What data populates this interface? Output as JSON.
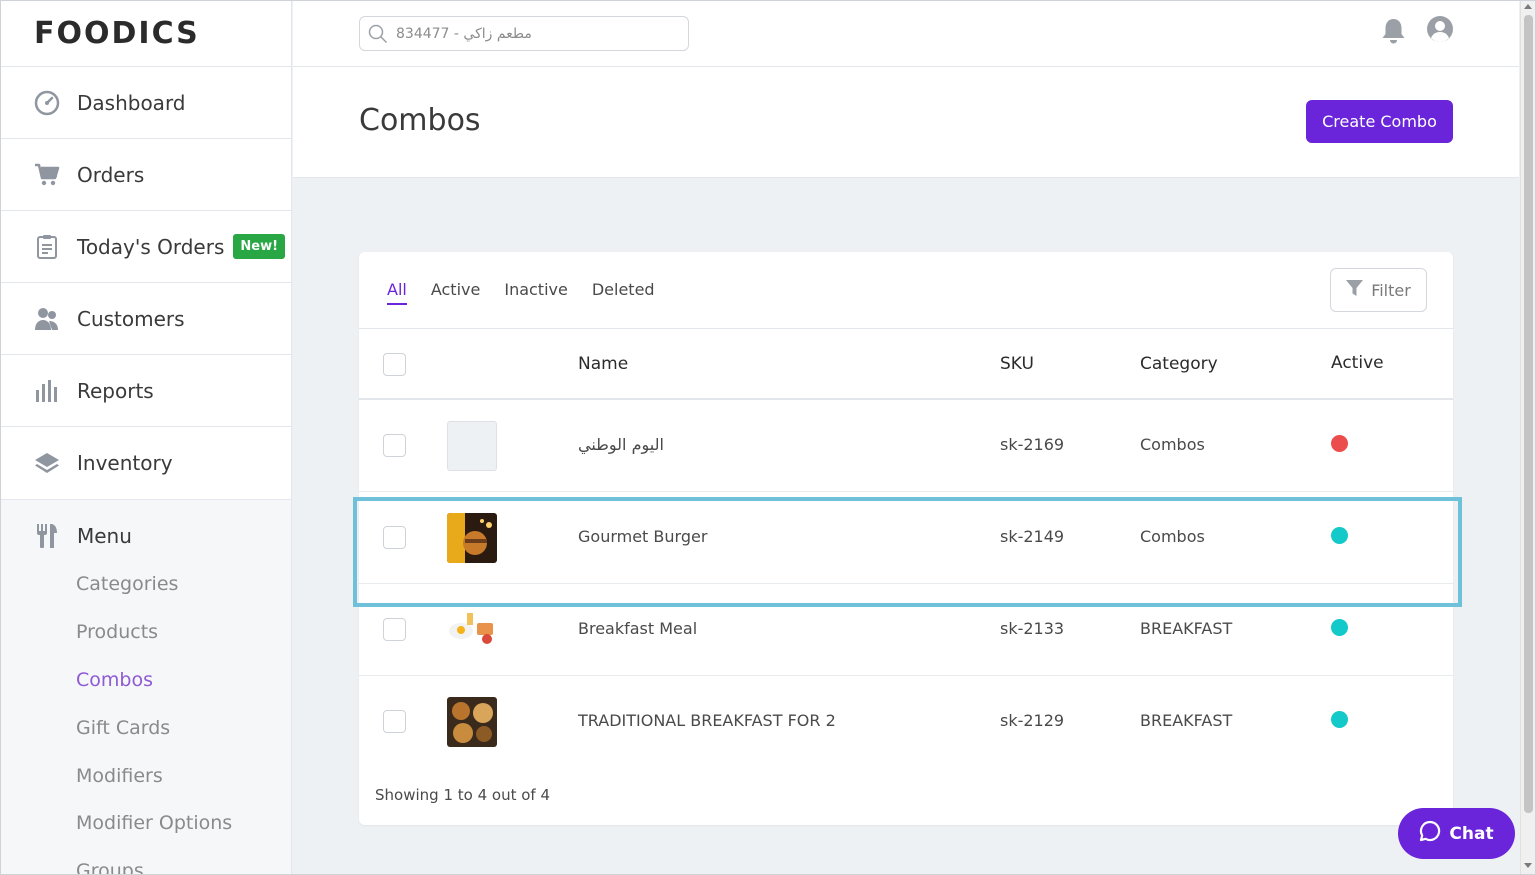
{
  "app": {
    "logo_text": "FOODICS"
  },
  "topbar": {
    "search_placeholder": "مطعم زاكي - 834477"
  },
  "sidebar": {
    "items": [
      {
        "label": "Dashboard",
        "icon": "dashboard-gauge-icon"
      },
      {
        "label": "Orders",
        "icon": "cart-icon"
      },
      {
        "label": "Today's Orders",
        "icon": "clipboard-icon",
        "badge": "New!"
      },
      {
        "label": "Customers",
        "icon": "users-icon"
      },
      {
        "label": "Reports",
        "icon": "bar-chart-icon"
      },
      {
        "label": "Inventory",
        "icon": "layers-icon"
      }
    ],
    "menu": {
      "label": "Menu",
      "icon": "fork-knife-icon",
      "sub_items": [
        "Categories",
        "Products",
        "Combos",
        "Gift Cards",
        "Modifiers",
        "Modifier Options",
        "Groups"
      ],
      "active": "Combos"
    }
  },
  "page": {
    "title": "Combos",
    "create_label": "Create Combo"
  },
  "filters": {
    "tabs": [
      "All",
      "Active",
      "Inactive",
      "Deleted"
    ],
    "active_tab": "All",
    "filter_label": "Filter"
  },
  "table": {
    "columns": [
      "Name",
      "SKU",
      "Category",
      "Active"
    ],
    "rows": [
      {
        "name": "اليوم الوطني",
        "sku": "sk-2169",
        "category": "Combos",
        "active": false
      },
      {
        "name": "Gourmet Burger",
        "sku": "sk-2149",
        "category": "Combos",
        "active": true
      },
      {
        "name": "Breakfast Meal",
        "sku": "sk-2133",
        "category": "BREAKFAST",
        "active": true
      },
      {
        "name": "TRADITIONAL BREAKFAST FOR 2",
        "sku": "sk-2129",
        "category": "BREAKFAST",
        "active": true
      }
    ],
    "showing": "Showing 1 to 4 out of 4"
  },
  "chat": {
    "label": "Chat"
  },
  "colors": {
    "brand": "#6a24d9",
    "active_dot": "#14c9c9",
    "inactive_dot": "#eb4d4d",
    "badge_new": "#29a745",
    "highlight": "#6ec1d8"
  }
}
